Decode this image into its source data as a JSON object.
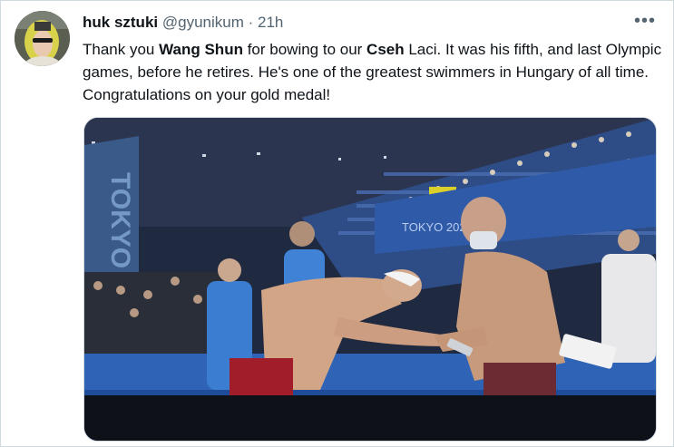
{
  "tweet": {
    "author_name": "huk sztuki",
    "author_handle": "@gyunikum",
    "separator": "·",
    "time": "21h",
    "more_label": "•••",
    "text_parts": {
      "p1": "Thank you ",
      "p2": "Wang Shun",
      "p3": " for bowing to our ",
      "p4": "Cseh",
      "p5": " Laci. It was his fifth, and last Olympic games, before he retires. He's one of the greatest swimmers in Hungary of all time. Congratulations on your gold medal!"
    }
  },
  "media": {
    "venue_text_vertical": "TOKYO",
    "banner_text": "TOKYO 2020"
  }
}
